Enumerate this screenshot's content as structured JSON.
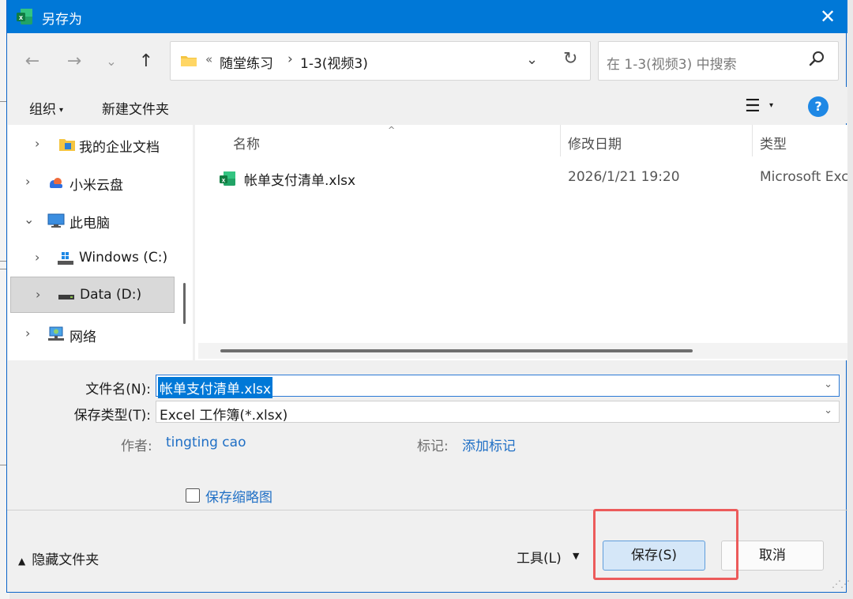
{
  "window": {
    "title": "另存为",
    "close_icon": "close-icon"
  },
  "address_bar": {
    "overflow": "«",
    "crumbs": [
      "随堂练习",
      "1-3(视频3)"
    ],
    "separator": "›"
  },
  "search": {
    "placeholder": "在 1-3(视频3) 中搜索"
  },
  "toolbar": {
    "organize_label": "组织",
    "new_folder_label": "新建文件夹"
  },
  "nav_pane": {
    "items": [
      {
        "label": "我的企业文档",
        "icon": "folder-icon"
      },
      {
        "label": "小米云盘",
        "icon": "cloud-icon"
      },
      {
        "label": "此电脑",
        "icon": "computer-icon"
      },
      {
        "label": "Windows (C:)",
        "icon": "drive-icon"
      },
      {
        "label": "Data (D:)",
        "icon": "drive-icon",
        "selected": true
      },
      {
        "label": "网络",
        "icon": "network-icon"
      }
    ]
  },
  "file_list": {
    "columns": [
      "名称",
      "修改日期",
      "类型"
    ],
    "rows": [
      {
        "name": "帐单支付清单.xlsx",
        "modified": "2026/1/21 19:20",
        "type": "Microsoft Exc"
      }
    ]
  },
  "form": {
    "filename_label": "文件名(N):",
    "filename_value": "帐单支付清单.xlsx",
    "filetype_label": "保存类型(T):",
    "filetype_value": "Excel 工作簿(*.xlsx)",
    "author_label": "作者:",
    "author_value": "tingting cao",
    "tags_label": "标记:",
    "tags_value": "添加标记",
    "thumbnail_label": "保存缩略图"
  },
  "footer": {
    "hide_folders_label": "隐藏文件夹",
    "tools_label": "工具(L)",
    "save_label": "保存(S)",
    "cancel_label": "取消"
  },
  "colors": {
    "titlebar": "#0078d7",
    "link": "#1f6fc5",
    "highlight_box": "#ec5b5b"
  }
}
